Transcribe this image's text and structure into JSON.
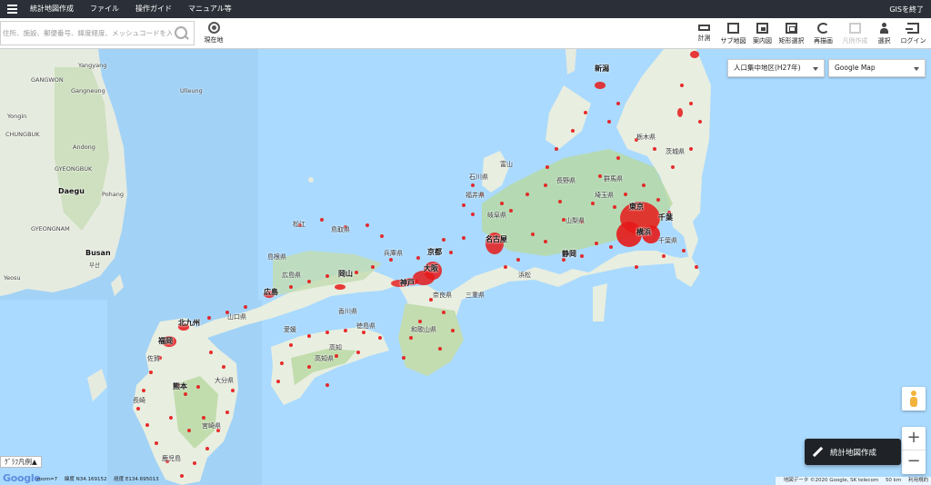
{
  "menubar": {
    "items": [
      "統計地図作成",
      "ファイル",
      "操作ガイド",
      "マニュアル等"
    ],
    "exit_label": "GISを終了"
  },
  "search": {
    "placeholder": "住所、施設、郵便番号、緯度経度、メッシュコードを入力"
  },
  "current_location_label": "現在地",
  "tools": [
    {
      "label": "計測",
      "icon": "ruler-icon",
      "enabled": true
    },
    {
      "label": "サブ地図",
      "icon": "map-icon",
      "enabled": true
    },
    {
      "label": "案内図",
      "icon": "frame-icon",
      "enabled": true
    },
    {
      "label": "矩形選択",
      "icon": "rect-select-icon",
      "enabled": true
    },
    {
      "label": "再描画",
      "icon": "reload-icon",
      "enabled": true
    },
    {
      "label": "凡例作成",
      "icon": "note-icon",
      "enabled": false
    },
    {
      "label": "選択",
      "icon": "select-person-icon",
      "enabled": true
    },
    {
      "label": "ログイン",
      "icon": "login-icon",
      "enabled": true
    }
  ],
  "layer_select": {
    "value": "人口集中地区(H27年)"
  },
  "basemap_select": {
    "value": "Google Map"
  },
  "map_labels": {
    "niigata": "新潟",
    "toyama": "富山",
    "ishikawa": "石川県",
    "fukui": "福井県",
    "nagano": "長野県",
    "gunma": "群馬県",
    "tochigi": "栃木県",
    "ibaraki": "茨城県",
    "saitama": "埼玉県",
    "tokyo": "東京",
    "chiba": "千葉",
    "chibaken": "千葉県",
    "yokohama": "横浜",
    "yamanashi": "山梨県",
    "shizuoka": "静岡",
    "nagoya": "名古屋",
    "gifu": "岐阜県",
    "hamamatsu": "浜松",
    "kyoto": "京都",
    "osaka": "大阪",
    "kobe": "神戸",
    "nara": "奈良県",
    "mie": "三重県",
    "wakayama": "和歌山県",
    "hyogo": "兵庫県",
    "tottori": "鳥取県",
    "matsue": "松江",
    "shimane": "島根県",
    "okayama": "岡山",
    "hiroshima": "広島",
    "hiroshimaken": "広島県",
    "yamaguchi": "山口県",
    "kagawa": "香川県",
    "tokushima": "徳島県",
    "ehime": "愛媛",
    "kochi": "高知",
    "kochiken": "高知県",
    "kitakyushu": "北九州",
    "fukuoka": "福岡",
    "saga": "佐賀",
    "nagasaki": "長崎",
    "kumamoto": "熊本",
    "oita": "大分県",
    "miyazaki": "宮崎県",
    "kagoshima": "鹿児島",
    "yangyang": "Yangyang",
    "gangwon": "GANGWON",
    "gangneung": "Gangneung",
    "yongin": "Yongin",
    "chungbuk": "CHUNGBUK",
    "andong": "Andong",
    "daegu": "Daegu",
    "pohang": "Pohang",
    "gyeongbuk": "GYEONGBUK",
    "gyeongnam": "GYEONGNAM",
    "busan": "Busan",
    "busan_kr": "부산",
    "ulleung": "Ulleung",
    "yeosu": "Yeosu",
    "jeju": "Jeju"
  },
  "create_map_button": "統計地図作成",
  "legend_tab": "ｸﾞﾗﾌ凡例▲",
  "google_logo": "Google",
  "status": {
    "zoom": "zoom=7",
    "latitude": "緯度 N34.169152",
    "longitude": "経度 E134.695013"
  },
  "copyright": {
    "mapdata": "地図データ ©2020 Google, SK telecom",
    "scale": "50 km",
    "terms": "利用規約"
  },
  "colors": {
    "sea": "#aadaff",
    "land": "#e8eee0",
    "forest": "#b8d8a0",
    "dots": "#e61919",
    "menubar": "#2b3038"
  }
}
